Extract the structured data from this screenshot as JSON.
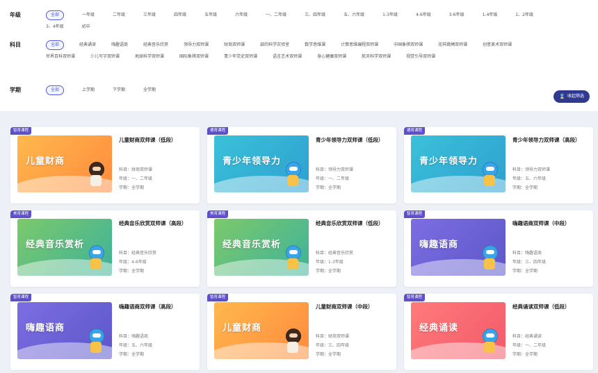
{
  "filters": {
    "grade": {
      "label": "年级",
      "options": [
        "全部",
        "一年级",
        "二年级",
        "三年级",
        "四年级",
        "五年级",
        "六年级",
        "一、二年级",
        "三、四年级",
        "五、六年级",
        "1-3年级",
        "4-6年级",
        "3-6年级",
        "1-4年级",
        "1、2年级",
        "3、4年级",
        "初中"
      ],
      "selected": "全部"
    },
    "subject": {
      "label": "科目",
      "options": [
        "全部",
        "经典诵读",
        "嗨趣语商",
        "经典音乐欣赏",
        "领导力双师课",
        "财商双师课",
        "啟的科学实验室",
        "数学思维课",
        "计算思维编程双师课",
        "中国象棋双师课",
        "花样跳绳双师课",
        "创意美术双师课",
        "世界百科双师课",
        "少儿写字双师课",
        "地球科学双师课",
        "国际象棋双师课",
        "青少年党史双师课",
        "语言艺术双师课",
        "身心健康双师课",
        "航天科学双师课",
        "视觉引导双师课"
      ],
      "selected": "全部"
    },
    "term": {
      "label": "学期",
      "options": [
        "全部",
        "上学期",
        "下学期",
        "全学期"
      ],
      "selected": "全部"
    },
    "collapse_label": "收起筛选",
    "collapse_icon": "hourglass-icon"
  },
  "courses": [
    {
      "tag": "智育课程",
      "thumb_title": "儿童财商",
      "theme": "orange",
      "mascot": "girl",
      "title": "儿童财商双师课（低段）",
      "subject": "科目：财商双师课",
      "grade": "年级：一、二年级",
      "term": "学期：全学期"
    },
    {
      "tag": "德育课程",
      "thumb_title": "青少年领导力",
      "theme": "teal",
      "mascot": "shark",
      "title": "青少年领导力双师课（低段）",
      "subject": "科目：领导力双师课",
      "grade": "年级：一、二年级",
      "term": "学期：全学期"
    },
    {
      "tag": "德育课程",
      "thumb_title": "青少年领导力",
      "theme": "teal",
      "mascot": "shark",
      "title": "青少年领导力双师课（高段）",
      "subject": "科目：领导力双师课",
      "grade": "年级：五、六年级",
      "term": "学期：全学期"
    },
    {
      "tag": "美育课程",
      "thumb_title": "经典音乐赏析",
      "theme": "green",
      "mascot": "shark",
      "title": "经典音乐欣赏双师课（高段）",
      "subject": "科目：经典音乐欣赏",
      "grade": "年级：4-6年级",
      "term": "学期：全学期"
    },
    {
      "tag": "美育课程",
      "thumb_title": "经典音乐赏析",
      "theme": "green",
      "mascot": "shark",
      "title": "经典音乐欣赏双师课（低段）",
      "subject": "科目：经典音乐欣赏",
      "grade": "年级：1-3年级",
      "term": "学期：全学期"
    },
    {
      "tag": "智育课程",
      "thumb_title": "嗨趣语商",
      "theme": "purple",
      "mascot": "shark",
      "title": "嗨趣语商双师课（中段）",
      "subject": "科目：嗨趣语商",
      "grade": "年级：三、四年级",
      "term": "学期：全学期"
    },
    {
      "tag": "智育课程",
      "thumb_title": "嗨趣语商",
      "theme": "purple",
      "mascot": "shark",
      "title": "嗨趣语商双师课（高段）",
      "subject": "科目：嗨趣语商",
      "grade": "年级：五、六年级",
      "term": "学期：全学期"
    },
    {
      "tag": "智育课程",
      "thumb_title": "儿童财商",
      "theme": "orange",
      "mascot": "girl",
      "title": "儿童财商双师课（中段）",
      "subject": "科目：财商双师课",
      "grade": "年级：三、四年级",
      "term": "学期：全学期"
    },
    {
      "tag": "智育课程",
      "thumb_title": "经典诵读",
      "theme": "red",
      "mascot": "shark",
      "title": "经典诵读双师课（低段）",
      "subject": "科目：经典诵读",
      "grade": "年级：一、二年级",
      "term": "学期：全学期"
    }
  ]
}
